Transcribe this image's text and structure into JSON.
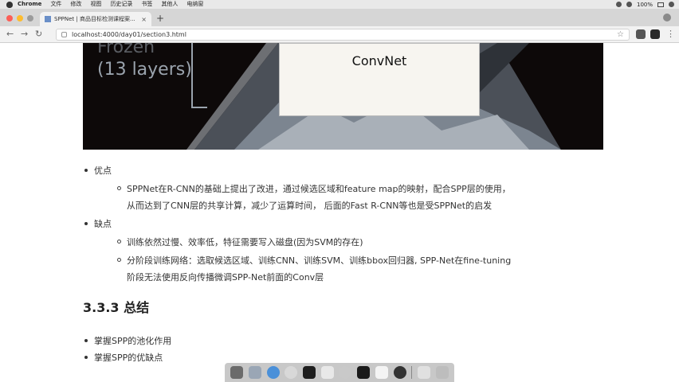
{
  "menubar": {
    "app": "Chrome",
    "items": [
      "文件",
      "修改",
      "视图",
      "历史记录",
      "书签",
      "其他人",
      "电纳窗"
    ],
    "battery": "100%"
  },
  "tab": {
    "title": "SPPNet | 商品目标检测课程案..."
  },
  "address": {
    "url": "localhost:4000/day01/section3.html"
  },
  "slide": {
    "frozen_line1": "Frozen",
    "frozen_line2": "(13 layers)",
    "convnet": "ConvNet"
  },
  "content": {
    "pros_label": "优点",
    "pros_line1": "SPPNet在R-CNN的基础上提出了改进，通过候选区域和feature map的映射，配合SPP层的使用，",
    "pros_line2": "从而达到了CNN层的共享计算，减少了运算时间， 后面的Fast R-CNN等也是受SPPNet的启发",
    "cons_label": "缺点",
    "cons_item1": "训练依然过慢、效率低，特征需要写入磁盘(因为SVM的存在)",
    "cons_item2_line1": "分阶段训练网络：选取候选区域、训练CNN、训练SVM、训练bbox回归器, SPP-Net在fine-tuning",
    "cons_item2_line2": "阶段无法使用反向传播微调SPP-Net前面的Conv层",
    "section_heading": "3.3.3 总结",
    "summary1": "掌握SPP的池化作用",
    "summary2": "掌握SPP的优缺点"
  },
  "colors": {
    "slide_bg": "#0d0909",
    "frozen_text": "#9aa3ad"
  }
}
